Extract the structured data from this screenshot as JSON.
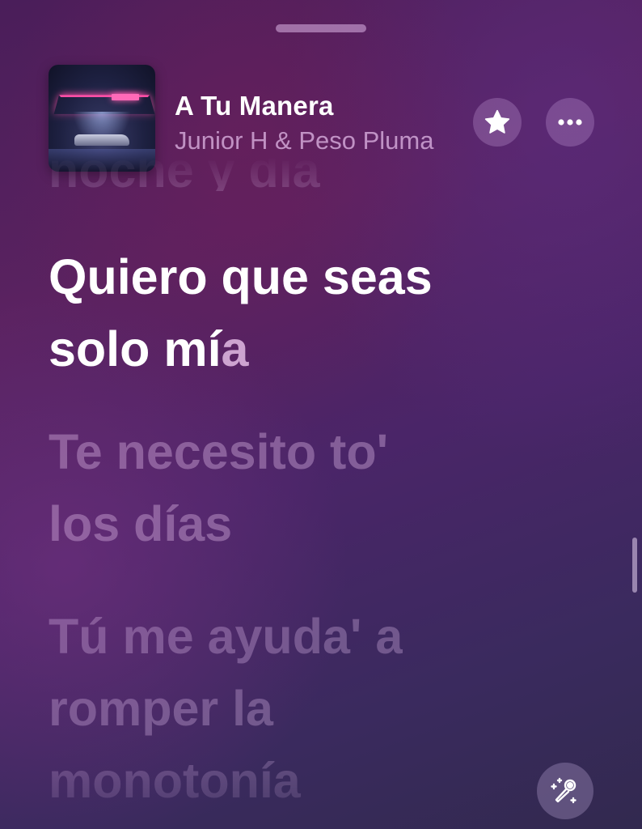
{
  "now_playing": {
    "title": "A Tu Manera",
    "artist": "Junior H & Peso Pluma",
    "artwork_icon": "album-artwork"
  },
  "controls": {
    "favorite_icon": "star-icon",
    "more_icon": "ellipsis-icon",
    "sing_icon": "microphone-sparkle-icon"
  },
  "lyrics": {
    "previous_line": "noche y día",
    "active_line_1": "Quiero que seas",
    "active_line_2_sung": "solo mí",
    "active_line_2_unsung": "a",
    "next_line_1": "Te necesito to'",
    "next_line_2": "los días",
    "later_line_1": "Tú me ayuda' a",
    "later_line_2": "romper la",
    "later_line_3": "monotonía"
  },
  "colors": {
    "background": "#4a2064",
    "active_lyric": "#ffffff",
    "inactive_lyric": "#b899c8"
  }
}
